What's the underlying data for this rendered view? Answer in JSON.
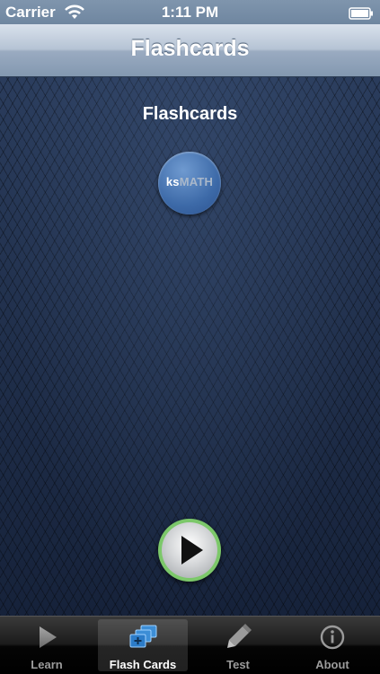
{
  "status_bar": {
    "carrier": "Carrier",
    "time": "1:11 PM"
  },
  "nav_bar": {
    "title": "Flashcards"
  },
  "content": {
    "heading": "Flashcards",
    "logo": {
      "prefix": "ks",
      "suffix": "MATH"
    }
  },
  "tab_bar": {
    "tabs": [
      {
        "label": "Learn",
        "icon": "play-icon",
        "selected": false
      },
      {
        "label": "Flash Cards",
        "icon": "cards-icon",
        "selected": true
      },
      {
        "label": "Test",
        "icon": "pencil-icon",
        "selected": false
      },
      {
        "label": "About",
        "icon": "info-icon",
        "selected": false
      }
    ]
  },
  "colors": {
    "nav_bar": "#9aabc1",
    "background": "#1d2b44",
    "play_button_ring": "#7cc86a",
    "logo": "#3d6aa8"
  }
}
